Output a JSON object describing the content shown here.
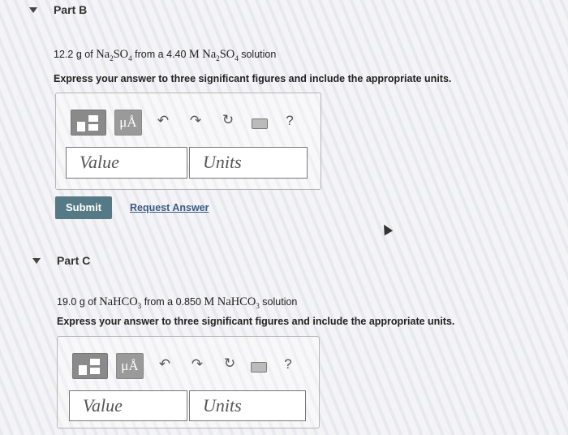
{
  "part_b": {
    "title": "Part B",
    "problem": {
      "mass": "12.2",
      "mass_unit": "g",
      "of": "of",
      "from_a": "from a",
      "molarity": "4.40",
      "molarity_unit": "M",
      "solution": "solution",
      "compound_base": "Na",
      "compound_sub1": "2",
      "compound_mid": "SO",
      "compound_sub2": "4"
    },
    "instruction": "Express your answer to three significant figures and include the appropriate units.",
    "toolbar": {
      "mu_label": "μÅ",
      "help_label": "?"
    },
    "value_placeholder": "Value",
    "units_placeholder": "Units",
    "submit_label": "Submit",
    "request_label": "Request Answer"
  },
  "part_c": {
    "title": "Part C",
    "problem": {
      "mass": "19.0",
      "mass_unit": "g",
      "of": "of",
      "from_a": "from a",
      "molarity": "0.850",
      "molarity_unit": "M",
      "solution": "solution",
      "compound_base": "NaHCO",
      "compound_sub": "3"
    },
    "instruction": "Express your answer to three significant figures and include the appropriate units.",
    "toolbar": {
      "mu_label": "μÅ",
      "help_label": "?"
    },
    "value_placeholder": "Value",
    "units_placeholder": "Units"
  }
}
